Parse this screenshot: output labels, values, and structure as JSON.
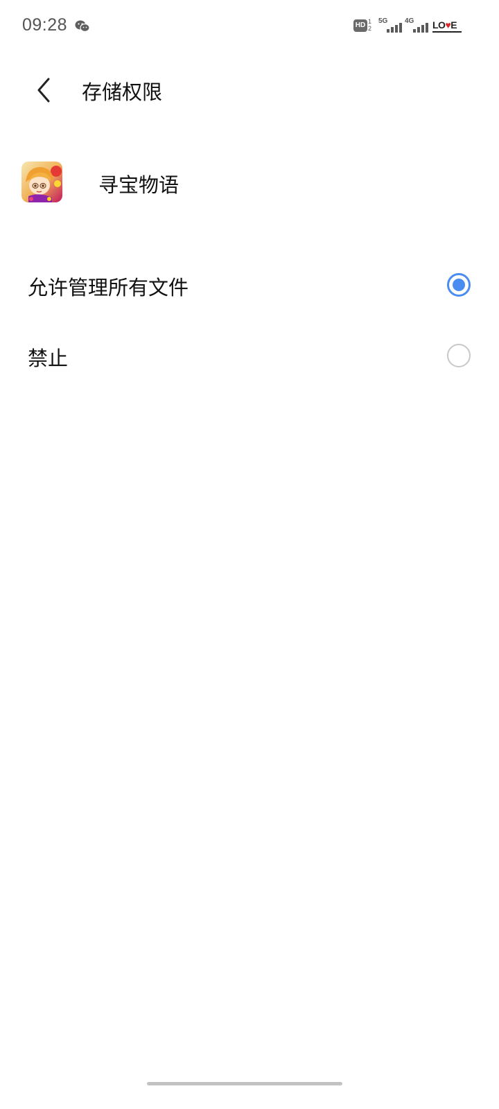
{
  "status_bar": {
    "time": "09:28",
    "hd_label": "HD",
    "hd_sim_top": "1",
    "hd_sim_bottom": "2",
    "network_1": "5G",
    "network_2": "4G",
    "carrier_badge": "LOVE"
  },
  "header": {
    "title": "存储权限"
  },
  "app": {
    "name": "寻宝物语"
  },
  "options": [
    {
      "label": "允许管理所有文件",
      "selected": true
    },
    {
      "label": "禁止",
      "selected": false
    }
  ],
  "colors": {
    "accent": "#4a8df0",
    "radio_off": "#c8c8c8"
  }
}
